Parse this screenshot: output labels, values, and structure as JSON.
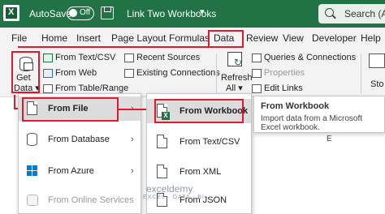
{
  "titlebar": {
    "autosave_label": "AutoSave",
    "toggle_state": "Off",
    "doc_title": "Link Two Workbooks",
    "search_placeholder": "Search (Alt"
  },
  "tabs": [
    "File",
    "Home",
    "Insert",
    "Page Layout",
    "Formulas",
    "Data",
    "Review",
    "View",
    "Developer",
    "Help"
  ],
  "ribbon": {
    "get_data_line1": "Get",
    "get_data_line2": "Data",
    "get_group": [
      "From Text/CSV",
      "From Web",
      "From Table/Range"
    ],
    "recent_group": [
      "Recent Sources",
      "Existing Connections"
    ],
    "refresh_line1": "Refresh",
    "refresh_line2": "All",
    "queries_group": [
      "Queries & Connections",
      "Properties",
      "Edit Links"
    ],
    "store_label": "Sto"
  },
  "menu_main": [
    "From File",
    "From Database",
    "From Azure",
    "From Online Services"
  ],
  "menu_file": [
    "From Workbook",
    "From Text/CSV",
    "From XML",
    "From JSON"
  ],
  "tooltip": {
    "title": "From Workbook",
    "description": "Import data from a Microsoft Excel workbook."
  },
  "sheet": {
    "column_e": "E"
  },
  "watermark": {
    "name": "exceldemy",
    "tagline": "EXCEL · DATA · BI"
  },
  "colors": {
    "excel_green": "#217346",
    "highlight_red": "#e0192e",
    "menu_hover": "#dcdcdc"
  }
}
